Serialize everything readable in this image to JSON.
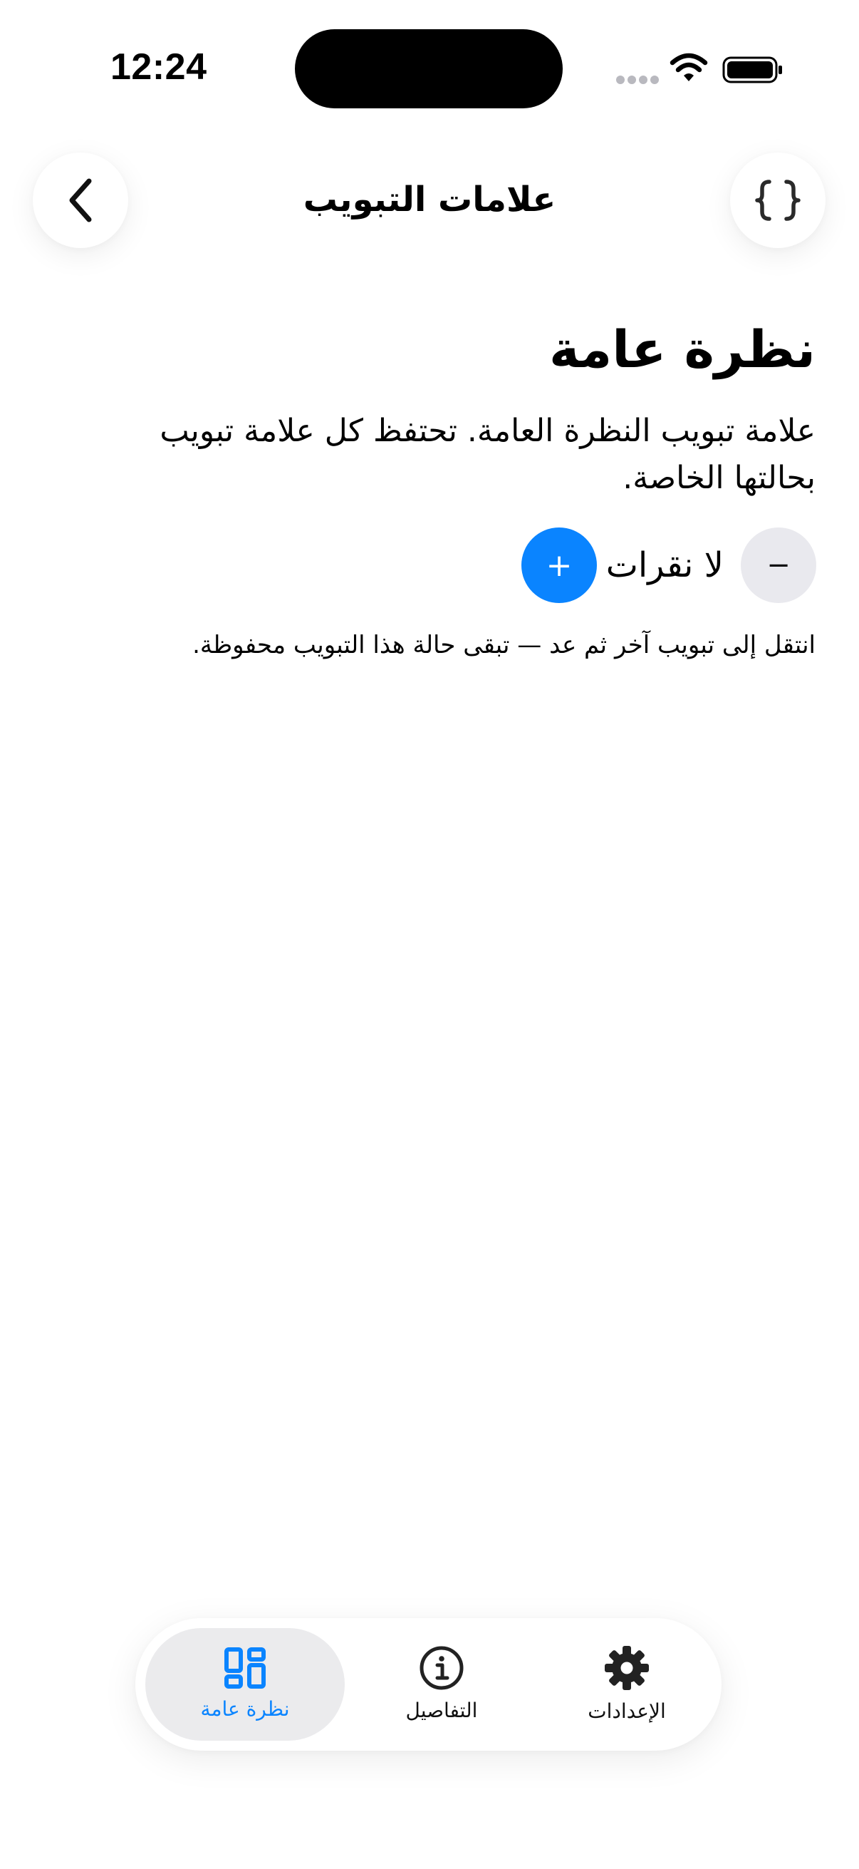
{
  "status_bar": {
    "time": "12:24"
  },
  "nav": {
    "title": "علامات التبويب",
    "back_icon": "chevron-left-icon",
    "code_icon": "braces-icon"
  },
  "main": {
    "heading": "نظرة عامة",
    "description": "علامة تبويب النظرة العامة. تحتفظ كل علامة تبويب بحالتها الخاصة.",
    "counter": {
      "minus_label": "−",
      "value_label": "لا نقرات",
      "plus_label": "+"
    },
    "hint": "انتقل إلى تبويب آخر ثم عد — تبقى حالة هذا التبويب محفوظة."
  },
  "tab_bar": {
    "tabs": [
      {
        "label": "نظرة عامة",
        "icon": "dashboard-grid-icon",
        "selected": true
      },
      {
        "label": "التفاصيل",
        "icon": "info-circle-icon",
        "selected": false
      },
      {
        "label": "الإعدادات",
        "icon": "gear-icon",
        "selected": false
      }
    ]
  },
  "colors": {
    "accent": "#0a84ff",
    "minus_button_bg": "#e9e9ee",
    "selected_tab_bg": "#ebebed"
  }
}
